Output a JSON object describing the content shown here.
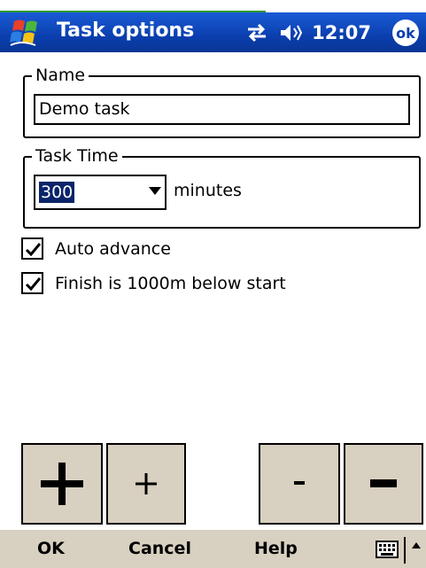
{
  "titlebar": {
    "title": "Task options",
    "time": "12:07",
    "ok_badge": "ok",
    "logo_icon": "windows-logo-icon",
    "connectivity_icon": "connectivity-icon",
    "volume_icon": "volume-icon"
  },
  "name_group": {
    "legend": "Name",
    "value": "Demo task"
  },
  "time_group": {
    "legend": "Task Time",
    "selected_value": "300",
    "unit": "minutes"
  },
  "checkboxes": [
    {
      "label": "Auto advance",
      "checked": true
    },
    {
      "label": "Finish is 1000m below start",
      "checked": true
    }
  ],
  "buttons": {
    "plus_big": "+",
    "plus_small": "+",
    "minus_small": "-",
    "minus_big": "-"
  },
  "menubar": {
    "ok": "OK",
    "cancel": "Cancel",
    "help": "Help",
    "keyboard_icon": "keyboard-icon"
  },
  "colors": {
    "titlebar": "#0b3fae",
    "button_face": "#d8d0c0",
    "selection": "#0a246a",
    "top_strip": "#2f9a2f"
  }
}
